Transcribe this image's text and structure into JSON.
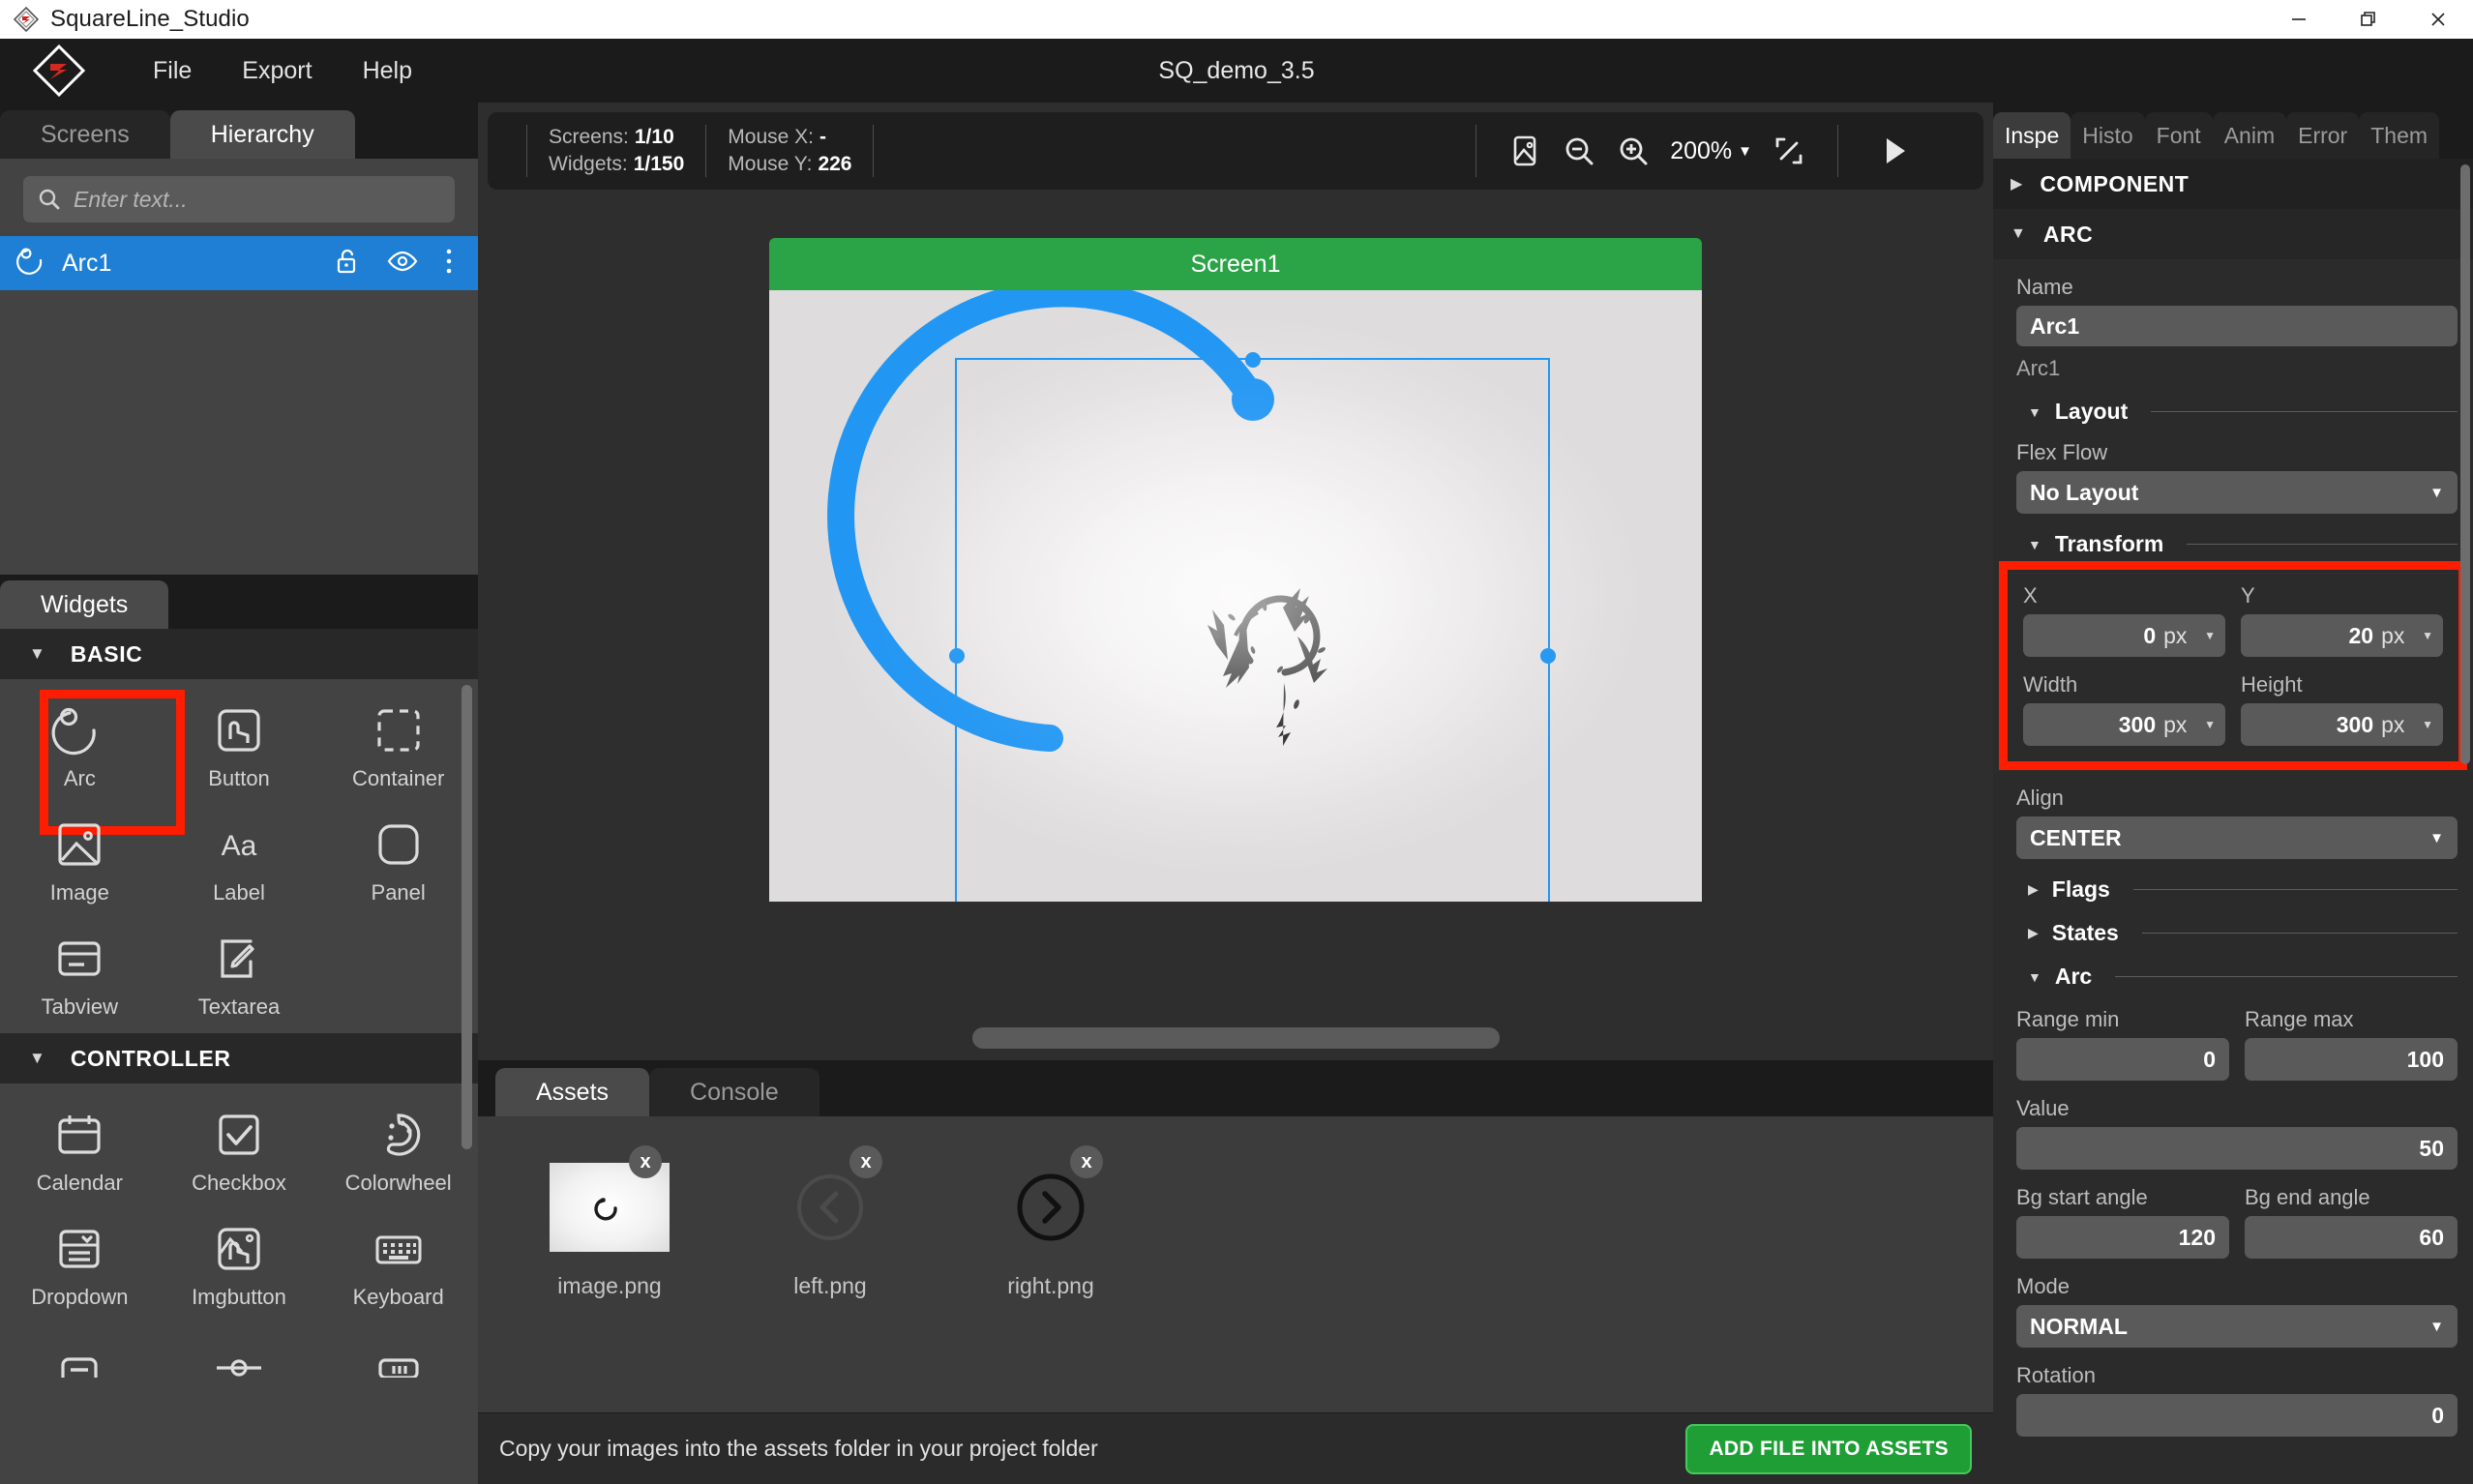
{
  "window": {
    "app_title": "SquareLine_Studio",
    "minimize": "minimize-icon",
    "restore": "restore-icon",
    "close": "close-icon"
  },
  "menubar": {
    "items": [
      "File",
      "Export",
      "Help"
    ],
    "project_title": "SQ_demo_3.5"
  },
  "left": {
    "tabs": [
      {
        "label": "Screens",
        "active": false
      },
      {
        "label": "Hierarchy",
        "active": true
      }
    ],
    "search": {
      "placeholder": "Enter text..."
    },
    "tree": [
      {
        "label": "Arc1",
        "icon": "arc-icon",
        "selected": true
      }
    ],
    "widgets_tab": "Widgets",
    "groups": [
      {
        "name": "BASIC",
        "expanded": true,
        "items": [
          {
            "label": "Arc",
            "icon": "arc-icon",
            "highlighted": true
          },
          {
            "label": "Button",
            "icon": "button-icon",
            "highlighted": false
          },
          {
            "label": "Container",
            "icon": "container-icon",
            "highlighted": false
          },
          {
            "label": "Image",
            "icon": "image-icon",
            "highlighted": false
          },
          {
            "label": "Label",
            "icon": "label-icon",
            "highlighted": false
          },
          {
            "label": "Panel",
            "icon": "panel-icon",
            "highlighted": false
          },
          {
            "label": "Tabview",
            "icon": "tabview-icon",
            "highlighted": false
          },
          {
            "label": "Textarea",
            "icon": "textarea-icon",
            "highlighted": false
          }
        ]
      },
      {
        "name": "CONTROLLER",
        "expanded": true,
        "items": [
          {
            "label": "Calendar",
            "icon": "calendar-icon",
            "highlighted": false
          },
          {
            "label": "Checkbox",
            "icon": "checkbox-icon",
            "highlighted": false
          },
          {
            "label": "Colorwheel",
            "icon": "colorwheel-icon",
            "highlighted": false
          },
          {
            "label": "Dropdown",
            "icon": "dropdown-icon",
            "highlighted": false
          },
          {
            "label": "Imgbutton",
            "icon": "imgbutton-icon",
            "highlighted": false
          },
          {
            "label": "Keyboard",
            "icon": "keyboard-icon",
            "highlighted": false
          }
        ]
      }
    ]
  },
  "toolbar": {
    "screens_label": "Screens:",
    "screens_value": "1/10",
    "widgets_label": "Widgets:",
    "widgets_value": "1/150",
    "mouse_x_label": "Mouse X:",
    "mouse_x_value": "-",
    "mouse_y_label": "Mouse Y:",
    "mouse_y_value": "226",
    "screenshot_icon": "screenshot-icon",
    "zoom_out_icon": "zoom-out-icon",
    "zoom_in_icon": "zoom-in-icon",
    "zoom_level": "200%",
    "fit_icon": "fit-screen-icon",
    "play_icon": "play-icon"
  },
  "canvas": {
    "screen_name": "Screen1",
    "arc_color": "#2196f3",
    "selection_color": "#2196f3"
  },
  "assets": {
    "tabs": [
      {
        "label": "Assets",
        "active": true
      },
      {
        "label": "Console",
        "active": false
      }
    ],
    "files": [
      {
        "name": "image.png",
        "thumb": "arc-thumbnail",
        "remove": "x"
      },
      {
        "name": "left.png",
        "thumb": "chevron-left-circle",
        "remove": "x"
      },
      {
        "name": "right.png",
        "thumb": "chevron-right-circle",
        "remove": "x"
      }
    ]
  },
  "statusbar": {
    "message": "Copy your images into the assets folder in your project folder",
    "add_file_button": "ADD FILE INTO ASSETS",
    "add_file_color": "#1f9e36"
  },
  "inspector": {
    "tabs": [
      {
        "label": "Inspe",
        "active": true
      },
      {
        "label": "Histo",
        "active": false
      },
      {
        "label": "Font",
        "active": false
      },
      {
        "label": "Anim",
        "active": false
      },
      {
        "label": "Error",
        "active": false
      },
      {
        "label": "Them",
        "active": false
      }
    ],
    "sections": {
      "component": {
        "title": "COMPONENT",
        "expanded": false
      },
      "arc": {
        "title": "ARC",
        "expanded": true
      }
    },
    "name_label": "Name",
    "name_value": "Arc1",
    "name_sub": "Arc1",
    "layout": {
      "title": "Layout",
      "flex_flow_label": "Flex Flow",
      "flex_flow_value": "No Layout"
    },
    "transform": {
      "title": "Transform",
      "highlighted": true,
      "x_label": "X",
      "x_value": "0",
      "x_unit": "px",
      "y_label": "Y",
      "y_value": "20",
      "y_unit": "px",
      "width_label": "Width",
      "width_value": "300",
      "width_unit": "px",
      "height_label": "Height",
      "height_value": "300",
      "height_unit": "px"
    },
    "align_label": "Align",
    "align_value": "CENTER",
    "flags_title": "Flags",
    "states_title": "States",
    "arc_props": {
      "title": "Arc",
      "range_min_label": "Range min",
      "range_min_value": "0",
      "range_max_label": "Range max",
      "range_max_value": "100",
      "value_label": "Value",
      "value_value": "50",
      "bg_start_label": "Bg start angle",
      "bg_start_value": "120",
      "bg_end_label": "Bg end angle",
      "bg_end_value": "60",
      "mode_label": "Mode",
      "mode_value": "NORMAL",
      "rotation_label": "Rotation",
      "rotation_value": "0"
    }
  },
  "colors": {
    "accent_blue": "#1e7fd4",
    "highlight_red": "#ff1d00",
    "green": "#2ba347"
  }
}
